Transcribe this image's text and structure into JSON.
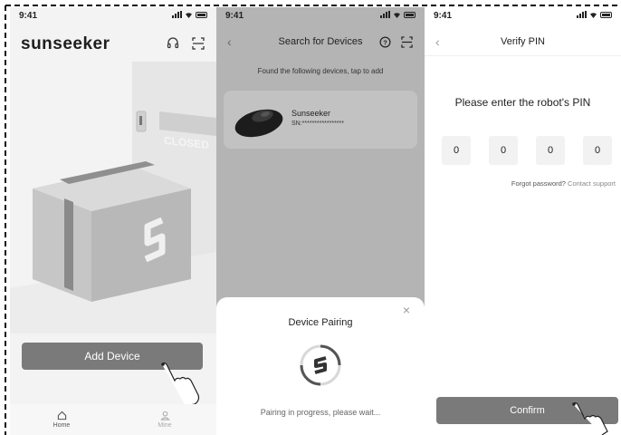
{
  "colors": {
    "button_gray": "#7a7a7a",
    "overlay_gray": "#b4b4b4"
  },
  "screen_home": {
    "time": "9:41",
    "logo_text": "sunseeker",
    "icons": [
      "headset-icon",
      "scan-icon"
    ],
    "door_sign": "CLOSED",
    "add_button_label": "Add Device",
    "tabs": [
      {
        "label": "Home",
        "icon": "home-icon",
        "active": true
      },
      {
        "label": "Mine",
        "icon": "user-icon",
        "active": false
      }
    ]
  },
  "screen_search": {
    "time": "9:41",
    "title": "Search for Devices",
    "subtitle": "Found the following devices, tap to add",
    "device": {
      "name": "Sunseeker",
      "sn": "SN:*****************"
    },
    "sheet": {
      "title": "Device Pairing",
      "message": "Pairing in progress, please wait..."
    }
  },
  "screen_pin": {
    "time": "9:41",
    "title": "Verify PIN",
    "prompt": "Please enter the robot's PIN",
    "pin_digits": [
      "0",
      "0",
      "0",
      "0"
    ],
    "forgot_text": "Forgot password?",
    "contact_link": "Contact support",
    "confirm_label": "Confirm"
  }
}
